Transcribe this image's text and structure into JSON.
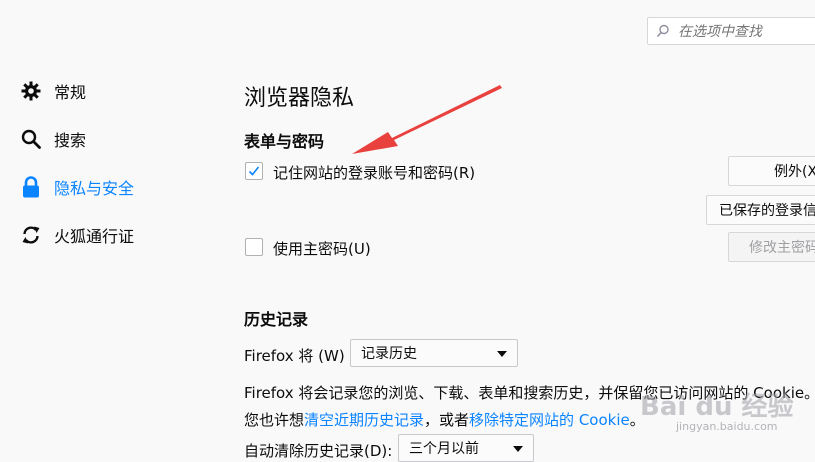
{
  "search": {
    "placeholder": "在选项中查找",
    "icon": "search-icon"
  },
  "sidebar": {
    "items": [
      {
        "label": "常规",
        "icon": "gear-icon",
        "selected": false
      },
      {
        "label": "搜索",
        "icon": "search-icon",
        "selected": false
      },
      {
        "label": "隐私与安全",
        "icon": "lock-icon",
        "selected": true
      },
      {
        "label": "火狐通行证",
        "icon": "sync-icon",
        "selected": false
      }
    ]
  },
  "main": {
    "title": "浏览器隐私",
    "forms": {
      "heading": "表单与密码",
      "remember_logins": {
        "label": "记住网站的登录账号和密码(R)",
        "checked": true
      },
      "exceptions_button": "例外(X",
      "saved_logins_button": "已保存的登录信",
      "master_password": {
        "label": "使用主密码(U)",
        "checked": false
      },
      "change_master_button": "修改主密码"
    },
    "history": {
      "heading": "历史记录",
      "firefox_will_label": "Firefox 将 (W)",
      "history_mode": "记录历史",
      "description": "Firefox 将会记录您的浏览、下载、表单和搜索历史，并保留您已访问网站的 Cookie。",
      "also_prefix": "您也许想",
      "clear_recent_link": "清空近期历史记录",
      "or_text": "，或者",
      "remove_cookies_link": "移除特定网站的 Cookie",
      "end_text": "。",
      "auto_clear_label": "自动清除历史记录(D):",
      "auto_clear_value": "三个月以前"
    }
  },
  "watermark": {
    "text": "Bai du 经验",
    "url": "jingyan.baidu.com"
  },
  "colors": {
    "accent": "#0a84ff",
    "annotation_arrow": "#e8413e"
  }
}
